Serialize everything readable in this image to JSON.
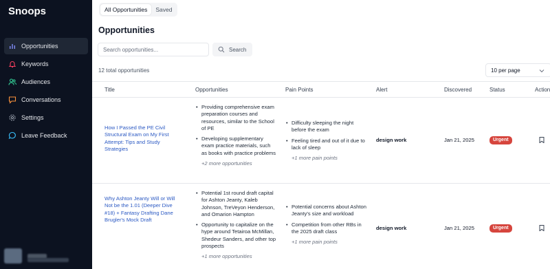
{
  "app": {
    "name": "Snoops"
  },
  "sidebar": {
    "items": [
      {
        "label": "Opportunities",
        "icon": "bar-chart-icon",
        "active": true
      },
      {
        "label": "Keywords",
        "icon": "bell-icon"
      },
      {
        "label": "Audiences",
        "icon": "users-icon"
      },
      {
        "label": "Conversations",
        "icon": "message-square-icon"
      },
      {
        "label": "Settings",
        "icon": "gear-icon"
      },
      {
        "label": "Leave Feedback",
        "icon": "message-circle-icon"
      }
    ]
  },
  "tabs": [
    {
      "label": "All Opportunities",
      "active": true
    },
    {
      "label": "Saved"
    }
  ],
  "page": {
    "title": "Opportunities"
  },
  "search": {
    "placeholder": "Search opportunities...",
    "button_label": "Search"
  },
  "summary": {
    "count_text": "12 total opportunities"
  },
  "pagination": {
    "per_page": "10 per page"
  },
  "table": {
    "columns": [
      "Title",
      "Opportunities",
      "Pain Points",
      "Alert",
      "Discovered",
      "Status",
      "Actions"
    ],
    "rows": [
      {
        "title": "How I Passed the PE Civil Structural Exam on My First Attempt: Tips and Study Strategies",
        "opportunities": [
          "Providing comprehensive exam preparation courses and resources, similar to the School of PE",
          "Developing supplementary exam practice materials, such as books with practice problems"
        ],
        "opportunities_more": "+2 more opportunities",
        "pain_points": [
          "Difficulty sleeping the night before the exam",
          "Feeling tired and out of it due to lack of sleep"
        ],
        "pain_points_more": "+1 more pain points",
        "alert": "design work",
        "discovered": "Jan 21, 2025",
        "status": "Urgent"
      },
      {
        "title": "Why Ashton Jeanty Will or Will Not be the 1.01 (Deeper Dive #18) + Fantasy Drafting Dane Brugler's Mock Draft",
        "opportunities": [
          "Potential 1st round draft capital for Ashton Jeanty, Kaleb Johnson, TreVeyon Henderson, and Omarion Hampton",
          "Opportunity to capitalize on the hype around Tetairoa McMillan, Shedeur Sanders, and other top prospects"
        ],
        "opportunities_more": "+1 more opportunities",
        "pain_points": [
          "Potential concerns about Ashton Jeanty's size and workload",
          "Competition from other RBs in the 2025 draft class"
        ],
        "pain_points_more": "+1 more pain points",
        "alert": "design work",
        "discovered": "Jan 21, 2025",
        "status": "Urgent"
      }
    ]
  },
  "colors": {
    "sidebar_bg": "#0c1220",
    "active_item_bg": "#1f2735",
    "link": "#2b59c3",
    "urgent_badge": "#d6453d"
  }
}
